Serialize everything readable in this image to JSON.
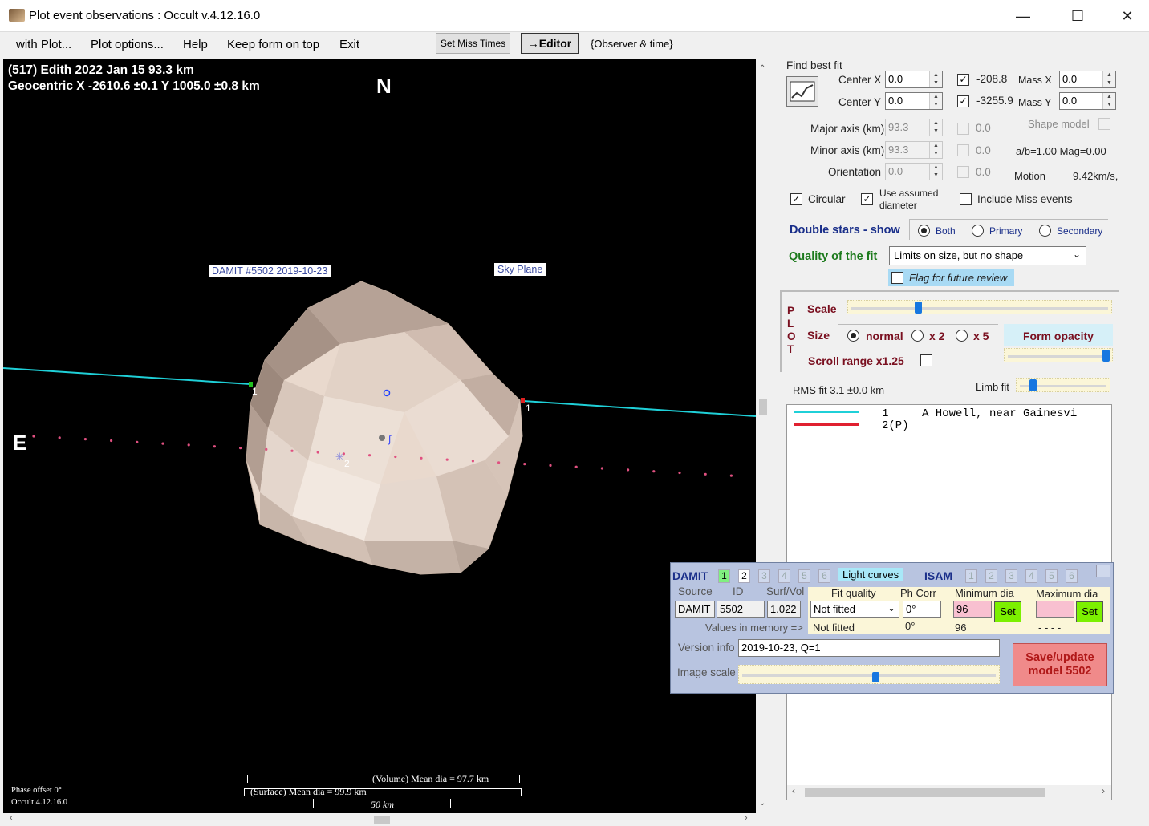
{
  "window": {
    "title": "Plot event observations : Occult v.4.12.16.0",
    "minimize": "—",
    "maximize": "☐",
    "close": "✕"
  },
  "menu": [
    "with Plot...",
    "Plot options...",
    "Help",
    "Keep form on top",
    "Exit"
  ],
  "toolbar": {
    "set_miss_times": "Set Miss Times",
    "editor": "→Editor",
    "observer_time": "{Observer & time}"
  },
  "plot": {
    "header_line1": "(517) Edith  2022 Jan 15  93.3 km",
    "header_line2": "Geocentric  X  -2610.6 ±0.1  Y 1005.0 ±0.8 km",
    "north": "N",
    "east": "E",
    "damit_label": "DAMIT #5502 2019-10-23",
    "sky_plane_label": "Sky Plane",
    "chord1_label_left": "1",
    "chord1_label_right": "1",
    "chord2_label": "2",
    "volume_dia": "(Volume) Mean dia = 97.7 km",
    "surface_dia": "(Surface) Mean dia = 99.9 km",
    "scale_bar": "50 km",
    "phase_offset": "Phase offset 0°",
    "occult_version": "Occult 4.12.16.0",
    "colors": {
      "chord1": "#1fd0d8",
      "chord2_dots": "#e0507a",
      "shape": "#e8d8cc"
    }
  },
  "fit": {
    "find_best_fit": "Find best fit",
    "center_x_label": "Center X",
    "center_x": "0.0",
    "center_y_label": "Center Y",
    "center_y": "0.0",
    "offset_x": "-208.8",
    "offset_y": "-3255.9",
    "mass_x_label": "Mass X",
    "mass_x": "0.0",
    "mass_y_label": "Mass Y",
    "mass_y": "0.0",
    "major_label": "Major axis (km)",
    "major": "93.3",
    "minor_label": "Minor axis (km)",
    "minor": "93.3",
    "orientation_label": "Orientation",
    "orientation": "0.0",
    "fixed_major": "0.0",
    "fixed_minor": "0.0",
    "fixed_orient": "0.0",
    "shape_model": "Shape model",
    "ab_mag": "a/b=1.00  Mag=0.00",
    "motion_label": "Motion",
    "motion": "9.42km/s,",
    "circular": "Circular",
    "use_assumed_1": "Use assumed",
    "use_assumed_2": "diameter",
    "include_miss": "Include Miss events",
    "double_stars": "Double stars - show",
    "both": "Both",
    "primary": "Primary",
    "secondary": "Secondary",
    "quality_label": "Quality of the fit",
    "quality_value": "Limits on size, but no shape",
    "flag_review": "Flag for future review"
  },
  "plotopts": {
    "vertical": [
      "P",
      "L",
      "O",
      "T"
    ],
    "scale": "Scale",
    "size": "Size",
    "normal": "normal",
    "x2": "x 2",
    "x5": "x 5",
    "form_opacity": "Form opacity",
    "scroll_range": "Scroll range x1.25",
    "rms_fit": "RMS fit  3.1 ±0.0 km",
    "limb_fit": "Limb fit",
    "scale_level": 0.25,
    "opacity_level": 0.97,
    "limb_level": 0.12
  },
  "observers": [
    {
      "num": "1",
      "name": "A Howell, near Gainesvi",
      "color": "#1fd0d8"
    },
    {
      "num": "2(P)",
      "name": "",
      "color": "#e02030"
    }
  ],
  "damit": {
    "damit_label": "DAMIT",
    "isam_label": "ISAM",
    "nums": [
      "1",
      "2",
      "3",
      "4",
      "5",
      "6"
    ],
    "light_curves": "Light curves",
    "source_h": "Source",
    "id_h": "ID",
    "surfvol_h": "Surf/Vol",
    "fitq_h": "Fit quality",
    "phcorr_h": "Ph Corr",
    "mindia_h": "Minimum dia",
    "maxdia_h": "Maximum dia",
    "source": "DAMIT",
    "id": "5502",
    "surfvol": "1.022",
    "fitq": "Not fitted",
    "phcorr": "0°",
    "mindia": "96",
    "maxdia": "",
    "set": "Set",
    "values_mem": "Values in memory =>",
    "mem_fitq": "Not fitted",
    "mem_phcorr": "0°",
    "mem_mindia": "96",
    "mem_maxdia": "- - - -",
    "version_label": "Version info",
    "version": "2019-10-23, Q=1",
    "image_scale": "Image scale",
    "save_line1": "Save/update",
    "save_line2": "model 5502",
    "image_scale_level": 0.52
  }
}
